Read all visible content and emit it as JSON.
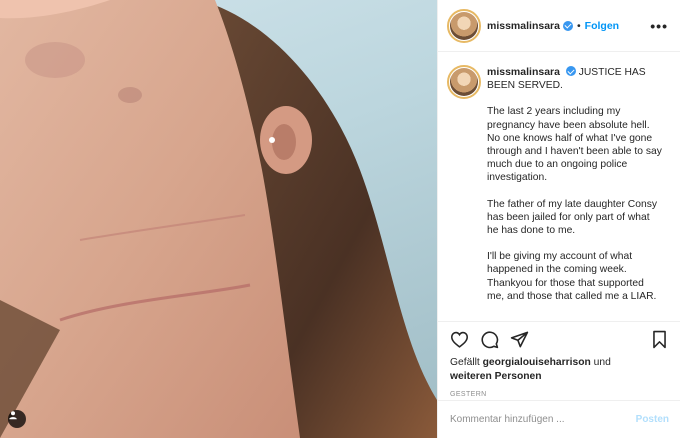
{
  "post": {
    "username": "missmalinsara",
    "follow_label": "Folgen",
    "more_label": "•••",
    "caption_title": "JUSTICE HAS BEEN SERVED.",
    "paragraphs": [
      "The last 2 years including my pregnancy have been absolute hell. No one knows half of what I've gone through and I haven't been able to say much due to an ongoing police investigation.",
      "The father of my late daughter Consy has been jailed for only part of what he has done to me.",
      "I'll be giving my account of what happened in the coming week. Thankyou for those that supported me, and those that called me a LIAR."
    ],
    "likes_prefix": "Gefällt",
    "likes_user": "georgialouiseharrison",
    "likes_connector": "und",
    "likes_rest": "weiteren Personen",
    "date": "GESTERN"
  },
  "comment": {
    "placeholder": "Kommentar hinzufügen ...",
    "post_label": "Posten"
  },
  "icons": {
    "like": "heart-icon",
    "comment": "comment-icon",
    "share": "share-icon",
    "save": "bookmark-icon",
    "tag": "user-tag-icon"
  },
  "colors": {
    "accent": "#0095f6",
    "verified": "#3897f0",
    "post_disabled": "#b2dffc"
  }
}
